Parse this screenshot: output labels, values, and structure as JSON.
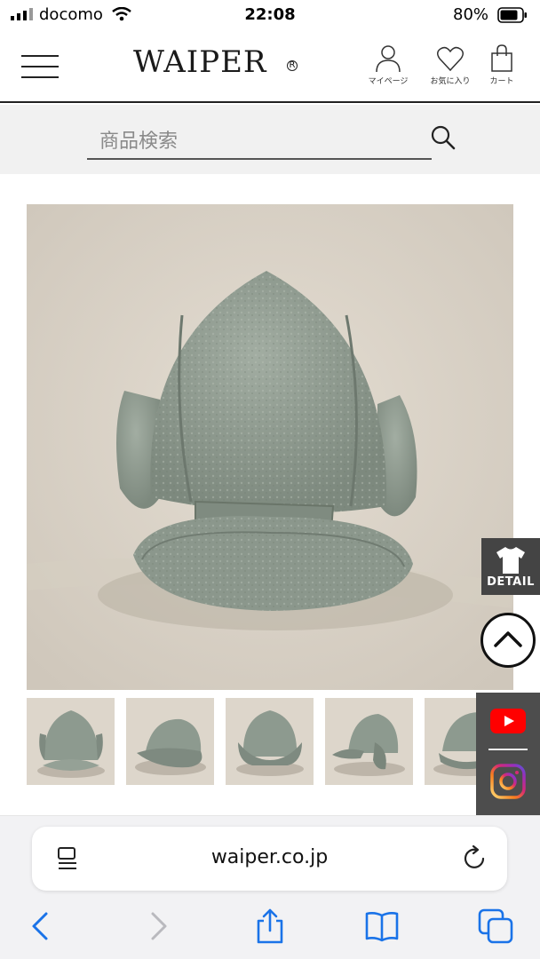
{
  "status_bar": {
    "carrier": "docomo",
    "time": "22:08",
    "battery_percent": "80%"
  },
  "header": {
    "logo_text": "WAIPER",
    "logo_mark": "R",
    "icons": [
      {
        "name": "mypage",
        "label": "マイページ",
        "icon": "person-icon"
      },
      {
        "name": "favorites",
        "label": "お気に入り",
        "icon": "heart-icon"
      },
      {
        "name": "cart",
        "label": "カート",
        "icon": "cart-icon"
      }
    ]
  },
  "search": {
    "placeholder": "商品検索",
    "icon": "search-icon"
  },
  "product": {
    "main_image": "olive-gray boa fleece cap with ear flaps",
    "thumbnails": [
      "front view",
      "rear view",
      "back view",
      "side view",
      "side view partial"
    ]
  },
  "side_buttons": {
    "detail_label": "DETAIL",
    "detail_icon": "tshirt-icon",
    "totop_icon": "chevron-up-icon",
    "social": [
      "youtube-icon",
      "instagram-icon"
    ]
  },
  "browser": {
    "url": "waiper.co.jp",
    "toolbar": [
      "back-icon",
      "forward-icon",
      "share-icon",
      "bookmarks-icon",
      "tabs-icon"
    ]
  },
  "colors": {
    "cap": "#8d9a8f",
    "floor": "#ddd6cb",
    "accent_blue": "#1a73e8",
    "panel_gray": "#4d4d4d"
  }
}
